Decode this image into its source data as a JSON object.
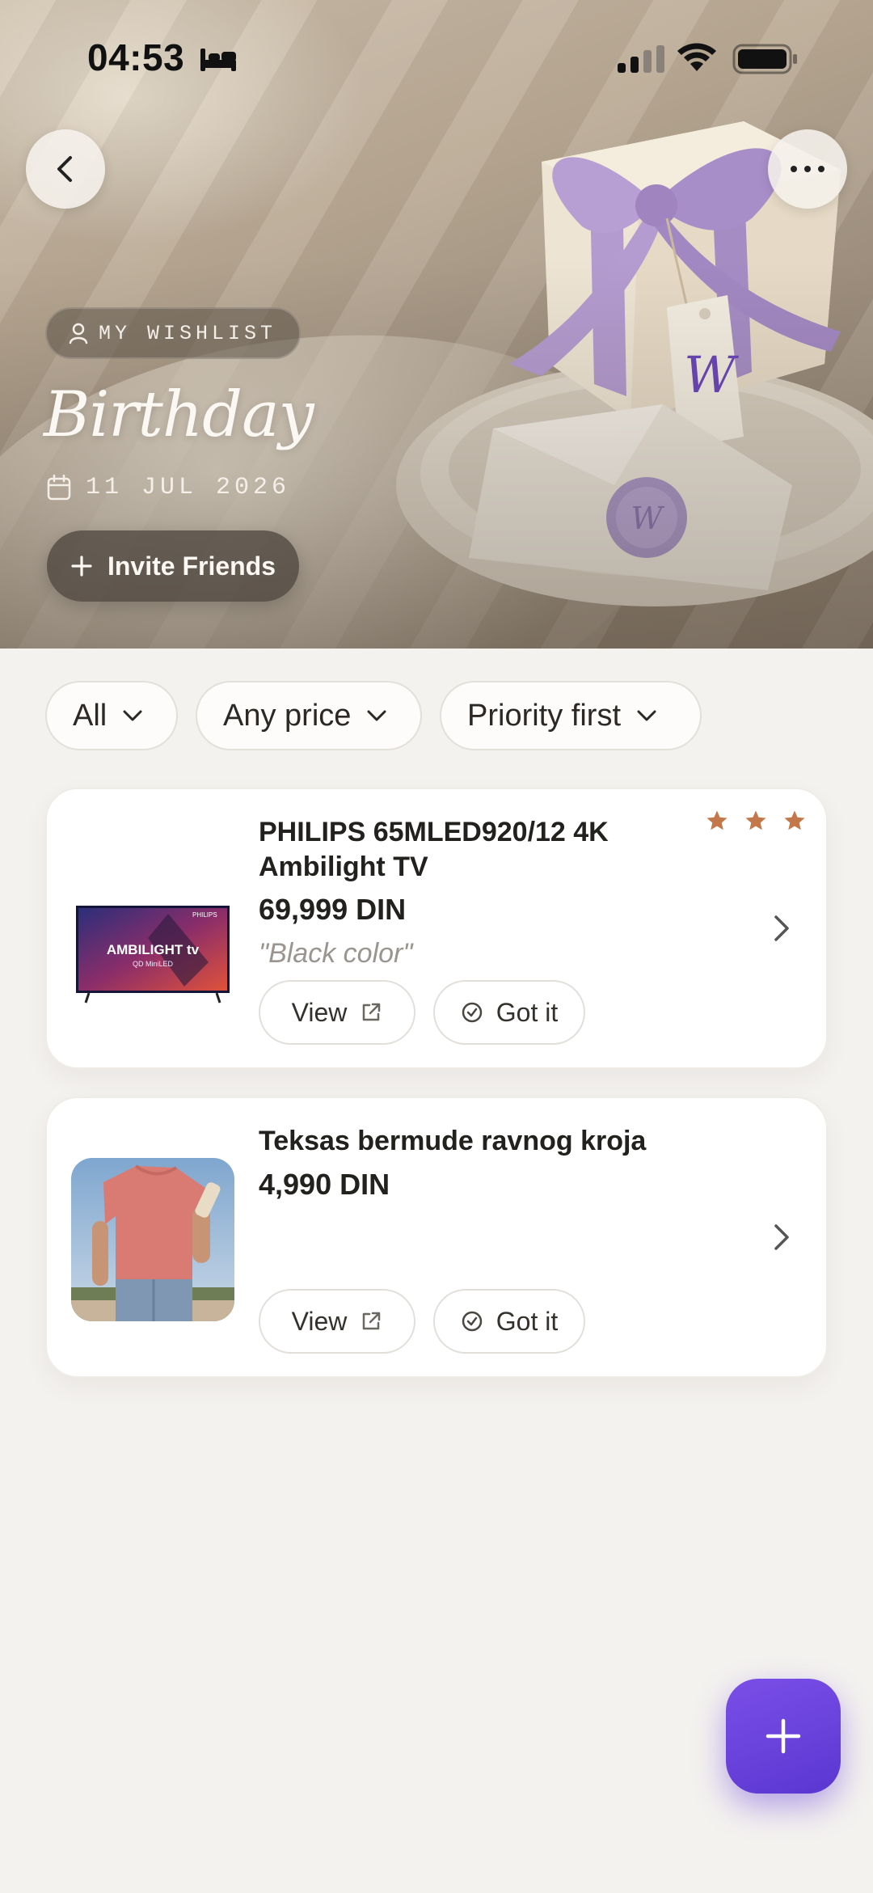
{
  "status_bar": {
    "time": "04:53"
  },
  "hero": {
    "badge": "MY WISHLIST",
    "title": "Birthday",
    "date": "11 JUL 2026",
    "invite_label": "Invite Friends"
  },
  "filters": [
    {
      "label": "All"
    },
    {
      "label": "Any price"
    },
    {
      "label": "Priority first"
    }
  ],
  "items": [
    {
      "name_line1": "PHILIPS 65MLED920/12 4K",
      "name_line2": "Ambilight TV",
      "price": "69,999 DIN",
      "note": "\"Black color\"",
      "priority_stars": 3,
      "thumbnail": "tv-product-image",
      "view_label": "View",
      "got_label": "Got it",
      "thumb_text": "AMBILIGHT tv",
      "thumb_sub": "QD MiniLED",
      "thumb_brand": "PHILIPS"
    },
    {
      "name_line1": "Teksas bermude ravnog kroja",
      "price": "4,990 DIN",
      "thumbnail": "shorts-product-image",
      "view_label": "View",
      "got_label": "Got it"
    }
  ],
  "colors": {
    "accent": "#6a42dc",
    "star": "#c4784a",
    "background": "#f4f2ef"
  }
}
